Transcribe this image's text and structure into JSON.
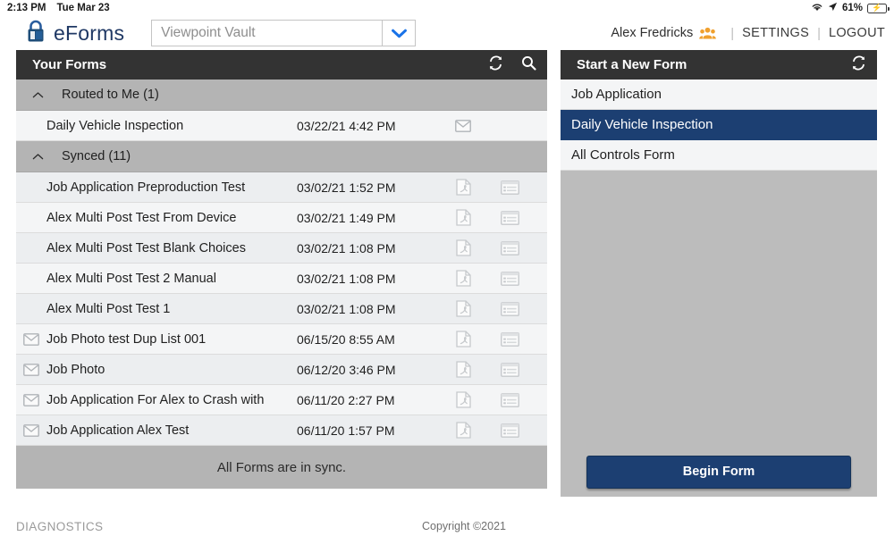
{
  "statusbar": {
    "time": "2:13 PM",
    "date": "Tue Mar 23",
    "battery_percent": "61%",
    "wifi_icon": "wifi-icon",
    "location_icon": "location-arrow-icon",
    "battery_icon": "battery-charging-icon"
  },
  "header": {
    "logo_icon": "padlock-icon",
    "brand": "eForms",
    "vault_select": {
      "value": "",
      "placeholder": "Viewpoint Vault",
      "caret_icon": "chevron-down-icon",
      "caret_color": "#1a73e8"
    },
    "user_name": "Alex Fredricks",
    "people_icon": "people-group-icon",
    "people_icon_color": "#f0a02e",
    "separator": "|",
    "settings_label": "SETTINGS",
    "logout_label": "LOGOUT"
  },
  "left_panel": {
    "title": "Your Forms",
    "refresh_icon": "refresh-icon",
    "search_icon": "search-icon",
    "groups": [
      {
        "label": "Routed to Me (1)",
        "chevron_icon": "chevron-up-icon",
        "rows": [
          {
            "name": "Daily Vehicle Inspection",
            "date": "03/22/21 4:42 PM",
            "leading_icon": "",
            "icons": [
              "envelope-icon"
            ]
          }
        ]
      },
      {
        "label": "Synced (11)",
        "chevron_icon": "chevron-up-icon",
        "rows": [
          {
            "name": "Job Application Preproduction Test",
            "date": "03/02/21 1:52 PM",
            "leading_icon": "",
            "icons": [
              "pdf-icon",
              "form-list-icon"
            ]
          },
          {
            "name": "Alex Multi Post Test From Device",
            "date": "03/02/21 1:49 PM",
            "leading_icon": "",
            "icons": [
              "pdf-icon",
              "form-list-icon"
            ]
          },
          {
            "name": "Alex Multi Post Test Blank Choices",
            "date": "03/02/21 1:08 PM",
            "leading_icon": "",
            "icons": [
              "pdf-icon",
              "form-list-icon"
            ]
          },
          {
            "name": "Alex Multi Post Test 2 Manual",
            "date": "03/02/21 1:08 PM",
            "leading_icon": "",
            "icons": [
              "pdf-icon",
              "form-list-icon"
            ]
          },
          {
            "name": "Alex Multi Post Test 1",
            "date": "03/02/21 1:08 PM",
            "leading_icon": "",
            "icons": [
              "pdf-icon",
              "form-list-icon"
            ]
          },
          {
            "name": "Job Photo test Dup List 001",
            "date": "06/15/20 8:55 AM",
            "leading_icon": "envelope-icon",
            "icons": [
              "pdf-icon",
              "form-list-icon"
            ]
          },
          {
            "name": "Job Photo",
            "date": "06/12/20 3:46 PM",
            "leading_icon": "envelope-icon",
            "icons": [
              "pdf-icon",
              "form-list-icon"
            ]
          },
          {
            "name": "Job Application For Alex to Crash with",
            "date": "06/11/20 2:27 PM",
            "leading_icon": "envelope-icon",
            "icons": [
              "pdf-icon",
              "form-list-icon"
            ]
          },
          {
            "name": "Job Application Alex Test",
            "date": "06/11/20 1:57 PM",
            "leading_icon": "envelope-icon",
            "icons": [
              "pdf-icon",
              "form-list-icon"
            ]
          }
        ]
      }
    ],
    "sync_status": "All Forms are in sync."
  },
  "right_panel": {
    "title": "Start a New Form",
    "refresh_icon": "refresh-icon",
    "items": [
      {
        "label": "Job Application",
        "selected": false
      },
      {
        "label": "Daily Vehicle Inspection",
        "selected": true
      },
      {
        "label": "All Controls Form",
        "selected": false
      }
    ],
    "begin_button": "Begin Form",
    "selected_color": "#1c3f72"
  },
  "footer": {
    "diagnostics": "DIAGNOSTICS",
    "copyright": "Copyright ©2021"
  }
}
